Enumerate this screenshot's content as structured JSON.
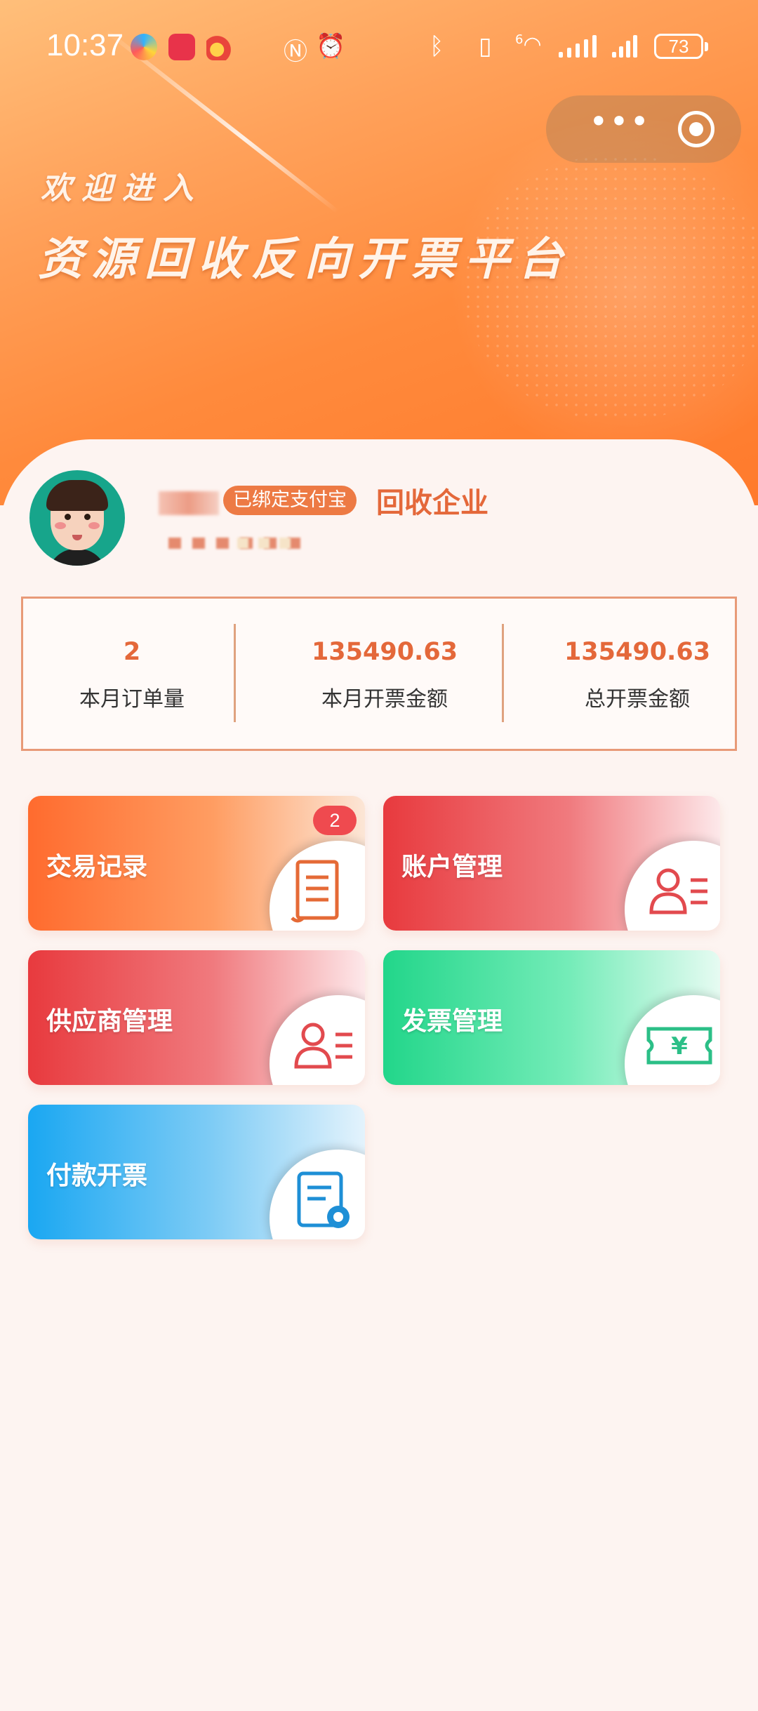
{
  "status_bar": {
    "time": "10:37",
    "battery": "73",
    "network_label": "6"
  },
  "banner": {
    "welcome": "欢迎进入",
    "platform_title": "资源回收反向开票平台"
  },
  "capsule": {
    "more_label": "•••"
  },
  "profile": {
    "bound_badge": "已绑定支付宝",
    "company_type": "回收企业"
  },
  "stats": [
    {
      "value": "2",
      "label": "本月订单量"
    },
    {
      "value": "135490.63",
      "label": "本月开票金额"
    },
    {
      "value": "135490.63",
      "label": "总开票金额"
    }
  ],
  "menu": [
    {
      "label": "交易记录",
      "icon": "document-icon",
      "badge": "2"
    },
    {
      "label": "账户管理",
      "icon": "user-list-icon"
    },
    {
      "label": "供应商管理",
      "icon": "user-list-icon"
    },
    {
      "label": "发票管理",
      "icon": "ticket-yen-icon"
    },
    {
      "label": "付款开票",
      "icon": "invoice-pay-icon"
    }
  ],
  "colors": {
    "accent": "#e4683a",
    "banner": "#ff8a3c",
    "badge": "#ef4a4f"
  }
}
